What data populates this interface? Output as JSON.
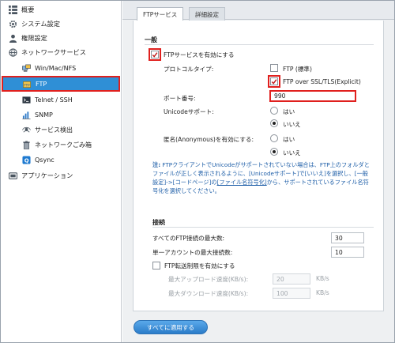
{
  "sidebar": {
    "items": [
      {
        "label": "概要",
        "icon": "grid-icon"
      },
      {
        "label": "システム設定",
        "icon": "gear-icon"
      },
      {
        "label": "権限設定",
        "icon": "user-icon"
      },
      {
        "label": "ネットワークサービス",
        "icon": "globe-icon"
      },
      {
        "label": "Win/Mac/NFS",
        "icon": "computers-icon"
      },
      {
        "label": "FTP",
        "icon": "ftp-folder-icon"
      },
      {
        "label": "Telnet / SSH",
        "icon": "terminal-icon"
      },
      {
        "label": "SNMP",
        "icon": "snmp-chart-icon"
      },
      {
        "label": "サービス検出",
        "icon": "discovery-icon"
      },
      {
        "label": "ネットワークごみ箱",
        "icon": "trash-icon"
      },
      {
        "label": "Qsync",
        "icon": "qsync-icon"
      },
      {
        "label": "アプリケーション",
        "icon": "applications-icon"
      }
    ]
  },
  "tabs": [
    {
      "label": "FTPサービス",
      "active": true
    },
    {
      "label": "詳細設定",
      "active": false
    }
  ],
  "general": {
    "title": "一般",
    "enable_ftp_label": "FTPサービスを有効にする",
    "enable_ftp_checked": true,
    "protocol_label": "プロトコルタイプ:",
    "ftp_standard_label": "FTP (標準)",
    "ftp_standard_checked": false,
    "ftp_ssl_label": "FTP over SSL/TLS(Explicit)",
    "ftp_ssl_checked": true,
    "port_label": "ポート番号:",
    "port_value": "990",
    "unicode_label": "Unicodeサポート:",
    "unicode_yes": "はい",
    "unicode_no": "いいえ",
    "unicode_selected": "いいえ",
    "anon_label": "匿名(Anonymous)を有効にする:",
    "anon_yes": "はい",
    "anon_no": "いいえ",
    "anon_selected": "いいえ"
  },
  "note": {
    "prefix": "注:",
    "text_1": " FTPクライアントでUnicodeがサポートされていない場合は、FTP上のフォルダと",
    "text_2": "ファイルが正しく表示されるように、[Unicodeサポート]で[いいえ]を選択し、[一般",
    "text_3a": "設定]->[コードページ]の",
    "link": "[ファイル名符号化]",
    "text_3b": "から、サポートされているファイル名符",
    "text_4": "号化を選択してください。"
  },
  "connection": {
    "title": "接続",
    "max_all_label": "すべてのFTP接続の最大数:",
    "max_all_value": "30",
    "max_single_label": "単一アカウントの最大接続数:",
    "max_single_value": "10",
    "throttle_label": "FTP転送制限を有効にする",
    "throttle_checked": false,
    "max_upload_label": "最大アップロード速度(KB/s):",
    "max_upload_value": "20",
    "max_download_label": "最大ダウンロード速度(KB/s):",
    "max_download_value": "100",
    "unit": "KB/s"
  },
  "apply_button": "すべてに適用する",
  "colors": {
    "accent": "#2f8fd6",
    "highlight": "#e0201e",
    "note": "#1f5fa8"
  }
}
